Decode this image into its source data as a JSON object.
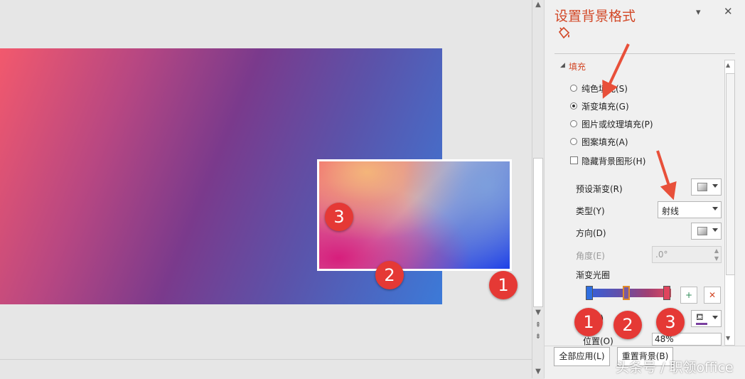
{
  "canvas": {
    "preview_badge": "3",
    "badge_bottom_center": "2",
    "badge_bottom_right": "1"
  },
  "pane": {
    "title": "设置背景格式",
    "section_fill": "填充",
    "options": {
      "solid": "纯色填充(S)",
      "gradient": "渐变填充(G)",
      "picture": "图片或纹理填充(P)",
      "pattern": "图案填充(A)"
    },
    "selected_option": "gradient",
    "hide_bg_graphics": "隐藏背景图形(H)",
    "preset_label": "预设渐变(R)",
    "type_label": "类型(Y)",
    "type_value": "射线",
    "direction_label": "方向(D)",
    "angle_label": "角度(E)",
    "angle_value": ".0°",
    "stops_label": "渐变光圈",
    "stops": [
      {
        "color": "#2f6fe0"
      },
      {
        "color": "#7a5aa0"
      },
      {
        "color": "#e0455e"
      }
    ],
    "color_label_partial": "C)",
    "stop_badges": [
      "1",
      "2",
      "3"
    ],
    "position_label": "位置(O)",
    "position_value": "48%",
    "apply_all": "全部应用(L)",
    "reset_bg": "重置背景(B)"
  },
  "watermark": "头条号 / 职领office",
  "colors": {
    "title": "#d24726",
    "badge": "#e53935",
    "arrow": "#e8503a"
  }
}
